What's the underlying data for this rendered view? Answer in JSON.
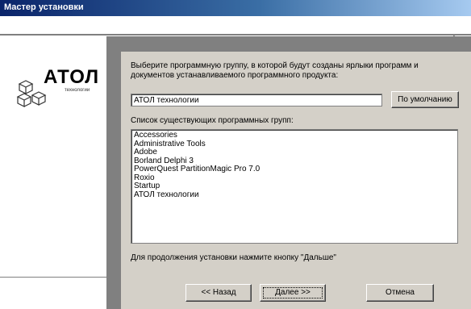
{
  "window": {
    "title": "Мастер установки"
  },
  "logo": {
    "brand": "АТОЛ",
    "subtitle": "технологии"
  },
  "content": {
    "instruction": "Выберите программную группу, в которой будут созданы ярлыки программ и документов устанавливаемого программного продукта:",
    "group_value": "АТОЛ технологии",
    "default_button": "По умолчанию",
    "list_label": "Список существующих программных групп:",
    "groups": [
      "Accessories",
      "Administrative Tools",
      "Adobe",
      "Borland Delphi 3",
      "PowerQuest PartitionMagic Pro 7.0",
      "Roxio",
      "Startup",
      "АТОЛ технологии"
    ],
    "continue_text": "Для продолжения установки нажмите кнопку \"Дальше\""
  },
  "buttons": {
    "back": "<< Назад",
    "next": "Далее >>",
    "cancel": "Отмена"
  },
  "colors": {
    "title_bar": "#0a246a",
    "panel": "#d4d0c8",
    "arrow": "#808080"
  }
}
